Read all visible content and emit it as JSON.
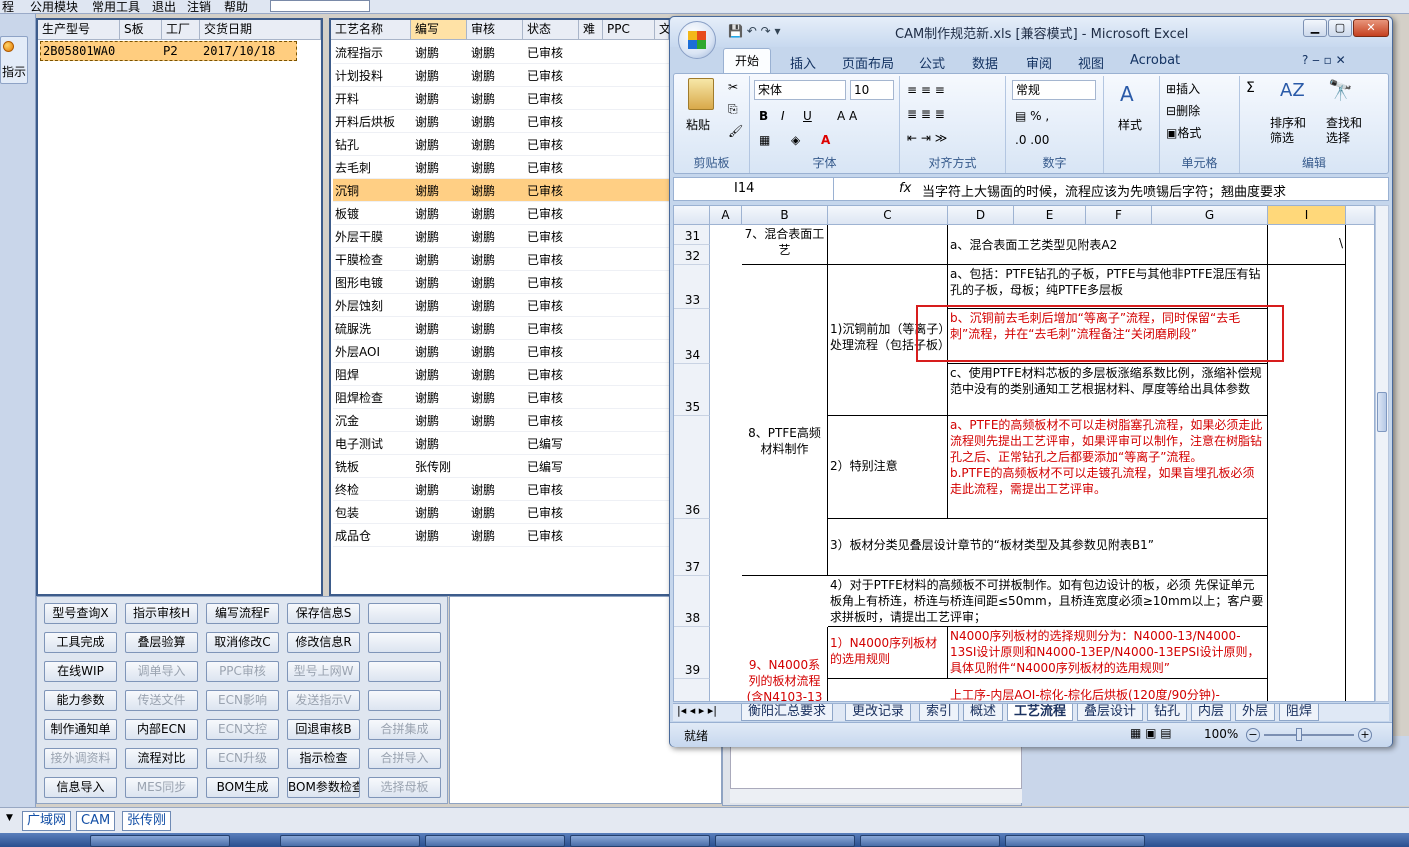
{
  "menubar": {
    "items": [
      "程",
      "公用模块",
      "常用工具",
      "退出",
      "注销",
      "帮助"
    ]
  },
  "sidebar": {
    "guide_button": "指示"
  },
  "orders": {
    "headers": [
      "生产型号",
      "S板",
      "工厂",
      "交货日期"
    ],
    "row": {
      "model": "2B05801WA0",
      "s": "",
      "factory": "P2",
      "date": "2017/10/18"
    }
  },
  "process": {
    "headers": [
      "工艺名称",
      "编写",
      "审核",
      "状态",
      "难",
      "PPC",
      "文"
    ],
    "rows": [
      {
        "name": "流程指示",
        "writer": "谢鹏",
        "reviewer": "谢鹏",
        "status": "已审核"
      },
      {
        "name": "计划投料",
        "writer": "谢鹏",
        "reviewer": "谢鹏",
        "status": "已审核"
      },
      {
        "name": "开料",
        "writer": "谢鹏",
        "reviewer": "谢鹏",
        "status": "已审核"
      },
      {
        "name": "开料后烘板",
        "writer": "谢鹏",
        "reviewer": "谢鹏",
        "status": "已审核"
      },
      {
        "name": "钻孔",
        "writer": "谢鹏",
        "reviewer": "谢鹏",
        "status": "已审核"
      },
      {
        "name": "去毛刺",
        "writer": "谢鹏",
        "reviewer": "谢鹏",
        "status": "已审核"
      },
      {
        "name": "沉铜",
        "writer": "谢鹏",
        "reviewer": "谢鹏",
        "status": "已审核"
      },
      {
        "name": "板镀",
        "writer": "谢鹏",
        "reviewer": "谢鹏",
        "status": "已审核"
      },
      {
        "name": "外层干膜",
        "writer": "谢鹏",
        "reviewer": "谢鹏",
        "status": "已审核"
      },
      {
        "name": "干膜检查",
        "writer": "谢鹏",
        "reviewer": "谢鹏",
        "status": "已审核"
      },
      {
        "name": "图形电镀",
        "writer": "谢鹏",
        "reviewer": "谢鹏",
        "status": "已审核"
      },
      {
        "name": "外层蚀刻",
        "writer": "谢鹏",
        "reviewer": "谢鹏",
        "status": "已审核"
      },
      {
        "name": "硫脲洗",
        "writer": "谢鹏",
        "reviewer": "谢鹏",
        "status": "已审核"
      },
      {
        "name": "外层AOI",
        "writer": "谢鹏",
        "reviewer": "谢鹏",
        "status": "已审核"
      },
      {
        "name": "阻焊",
        "writer": "谢鹏",
        "reviewer": "谢鹏",
        "status": "已审核"
      },
      {
        "name": "阻焊检查",
        "writer": "谢鹏",
        "reviewer": "谢鹏",
        "status": "已审核"
      },
      {
        "name": "沉金",
        "writer": "谢鹏",
        "reviewer": "谢鹏",
        "status": "已审核"
      },
      {
        "name": "电子测试",
        "writer": "谢鹏",
        "reviewer": "",
        "status": "已编写"
      },
      {
        "name": "铣板",
        "writer": "张传刚",
        "reviewer": "",
        "status": "已编写"
      },
      {
        "name": "终检",
        "writer": "谢鹏",
        "reviewer": "谢鹏",
        "status": "已审核"
      },
      {
        "name": "包装",
        "writer": "谢鹏",
        "reviewer": "谢鹏",
        "status": "已审核"
      },
      {
        "name": "成品仓",
        "writer": "谢鹏",
        "reviewer": "谢鹏",
        "status": "已审核"
      }
    ],
    "selected_index": 6
  },
  "buttons": [
    [
      "型号查询X",
      "指示审核H",
      "编写流程F",
      "保存信息S",
      ""
    ],
    [
      "工具完成",
      "叠层验算",
      "取消修改C",
      "修改信息R",
      ""
    ],
    [
      "在线WIP",
      "调单导入",
      "PPC审核",
      "型号上网W",
      ""
    ],
    [
      "能力参数",
      "传送文件",
      "ECN影响",
      "发送指示V",
      ""
    ],
    [
      "制作通知单",
      "内部ECN",
      "ECN文控",
      "回退审核B",
      "合拼集成"
    ],
    [
      "接外调资料",
      "流程对比",
      "ECN升级",
      "指示检查",
      "合拼导入"
    ],
    [
      "信息导入",
      "MES同步",
      "BOM生成",
      "BOM参数检查",
      "选择母板"
    ]
  ],
  "buttons_disabled": [
    [
      false,
      false,
      false,
      false,
      false
    ],
    [
      false,
      false,
      false,
      false,
      false
    ],
    [
      false,
      true,
      true,
      true,
      false
    ],
    [
      false,
      true,
      true,
      true,
      false
    ],
    [
      false,
      false,
      true,
      false,
      true
    ],
    [
      true,
      false,
      true,
      false,
      true
    ],
    [
      false,
      true,
      false,
      false,
      true
    ]
  ],
  "bottom_tabs": [
    "广域网",
    "CAM",
    "张传刚"
  ],
  "excel": {
    "title": "CAM制作规范新.xls  [兼容模式] - Microsoft Excel",
    "ribbon_tabs": [
      "开始",
      "插入",
      "页面布局",
      "公式",
      "数据",
      "审阅",
      "视图",
      "Acrobat"
    ],
    "ribbon": {
      "paste": "粘贴",
      "clipboard_group": "剪贴板",
      "font_name": "宋体",
      "font_size": "10",
      "font_group": "字体",
      "align_group": "对齐方式",
      "number_format": "常规",
      "number_group": "数字",
      "style": "样式",
      "insert": "插入",
      "delete": "删除",
      "format": "格式",
      "cells_group": "单元格",
      "sort": "排序和\n筛选",
      "find": "查找和\n选择",
      "edit_group": "编辑"
    },
    "name_box": "I14",
    "fx": "fx",
    "formula": "当字符上大锡面的时候，流程应该为先喷锡后字符；翘曲度要求",
    "columns": [
      "A",
      "B",
      "C",
      "D",
      "E",
      "F",
      "G",
      "I"
    ],
    "rows": [
      "31",
      "32",
      "33",
      "34",
      "35",
      "36",
      "37",
      "38",
      "39"
    ],
    "cells": {
      "b31": "7、混合表面工艺",
      "d31": "a、混合表面工艺类型见附表A2",
      "i31": "\\",
      "b_ptfe": "8、PTFE高频材料制作",
      "c_pre": "1)沉铜前加（等离子）处理流程（包括子板）",
      "d33": "a、包括：PTFE钻孔的子板，PTFE与其他非PTFE混压有钻孔的子板，母板；纯PTFE多层板",
      "d34": "b、沉铜前去毛刺后增加“等离子”流程，同时保留“去毛刺”流程，并在“去毛刺”流程备注“关闭磨刷段”",
      "d35": "c、使用PTFE材料芯板的多层板涨缩系数比例，涨缩补偿规范中没有的类别通知工艺根据材料、厚度等给出具体参数",
      "c36": "2）特别注意",
      "d36": "a、PTFE的高频板材不可以走树脂塞孔流程，如果必须走此流程则先提出工艺评审，如果评审可以制作，注意在树脂钻孔之后、正常钻孔之后都要添加“等离子”流程。\nb.PTFE的高频板材不可以走镀孔流程，如果盲埋孔板必须走此流程，需提出工艺评审。",
      "c37": "3）板材分类见叠层设计章节的“板材类型及其参数见附表B1”",
      "c38": "4）对于PTFE材料的高频板不可拼板制作。如有包边设计的板，必须 先保证单元板角上有桥连，桥连与桥连间距≤50mm，且桥连宽度必须≥10mm以上；客户要求拼板时，请提出工艺评审；",
      "b39": "9、N4000系列的板材流程(含N4103-13",
      "c39": "1）N4000序列板材的选用规则",
      "d39": "N4000序列板材的选择规则分为：N4000-13/N4000-13SI设计原则和N4000-13EP/N4000-13EPSI设计原则，具体见附件“N4000序列板材的选用规则”",
      "d40": "上工序-内层AOI-棕化-棕化后烘板(120度/90分钟)-"
    },
    "sheet_tabs": [
      "衡阳汇总要求",
      "更改记录",
      "索引",
      "概述",
      "工艺流程",
      "叠层设计",
      "钻孔",
      "内层",
      "外层",
      "阻焊"
    ],
    "active_sheet": "工艺流程",
    "status": "就绪",
    "zoom": "100%"
  },
  "colors": {
    "accent": "#ffcd7f",
    "highlight_box": "#d71d1d",
    "red_text": "#d30000",
    "panel_border": "#3d5c8b"
  }
}
